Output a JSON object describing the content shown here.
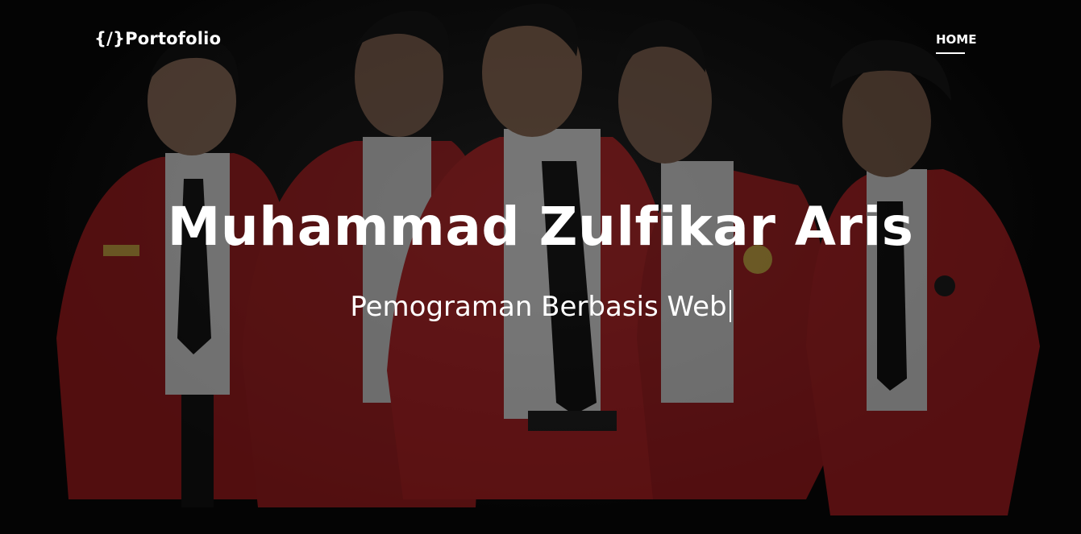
{
  "navbar": {
    "brand": "{/}Portofolio",
    "links": [
      {
        "label": "HOME"
      }
    ]
  },
  "hero": {
    "title": "Muhammad Zulfikar Aris",
    "subtitle": "Pemograman Berbasis Web"
  },
  "colors": {
    "text": "#ffffff",
    "jacket": "#b3151b",
    "background": "#0a0a0a"
  }
}
